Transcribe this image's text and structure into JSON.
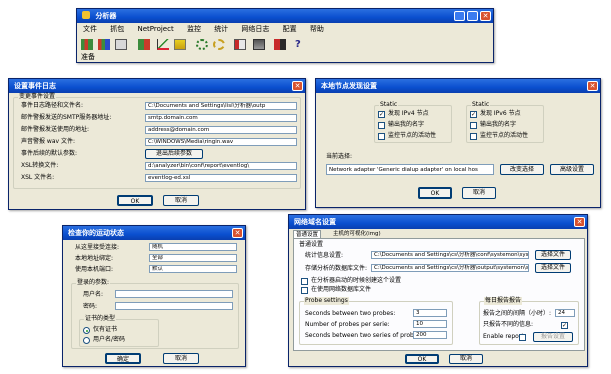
{
  "main_window": {
    "title": "分析器",
    "menu": [
      "文件",
      "抓包",
      "NetProject",
      "监控",
      "统计",
      "网络日志",
      "配置",
      "帮助"
    ],
    "toolbar_icons": [
      "tb-icon-1",
      "tb-icon-2",
      "tb-icon-3",
      "tb-icon-4",
      "tb-icon-5",
      "tb-icon-6",
      "tb-icon-7",
      "tb-icon-8",
      "tb-icon-9",
      "tb-icon-10"
    ],
    "status": "准备"
  },
  "log_dialog": {
    "title": "设置事件日志",
    "group_label": "变更事件设置",
    "rows": [
      {
        "label": "事件日志路径和文件名:",
        "value": "C:\\Documents and Settings\\lisi\\分析器\\outp"
      },
      {
        "label": "邮件警报发送的SMTP服务器地址:",
        "value": "smtp.domain.com"
      },
      {
        "label": "邮件警报发送使用的地址:",
        "value": "address@domain.com"
      },
      {
        "label": "声音警报 wav 文件:",
        "value": "C:\\WINDOWS\\Media\\ringin.wav"
      },
      {
        "label": "事件后续的默认参数:",
        "value": ""
      },
      {
        "label": "XSL转换文件:",
        "value": "d:\\analyzer\\bin\\conf\\report\\eventlog\\"
      },
      {
        "label": "XSL 文件名:",
        "value": "eventlog-ed.xsl"
      }
    ],
    "params_button": "退出后续参数",
    "ok": "OK",
    "cancel": "取消"
  },
  "node_dialog": {
    "title": "本地节点发现设置",
    "left_group": "Static",
    "left_checks": [
      {
        "label": "发现 IPv4 节点",
        "checked": true
      },
      {
        "label": "输出我的名字",
        "checked": false
      },
      {
        "label": "监控节点的活动性",
        "checked": false
      }
    ],
    "right_group": "Static",
    "right_checks": [
      {
        "label": "发现 IPv6 节点",
        "checked": true
      },
      {
        "label": "输出我的名字",
        "checked": false
      },
      {
        "label": "监控节点的活动性",
        "checked": false
      }
    ],
    "current_label": "当前选择:",
    "current_value": "Network adapter 'Generic dialup adapter' on local hos",
    "change_button": "改变选择",
    "advanced_button": "高级设置",
    "ok": "OK",
    "cancel": "取消"
  },
  "monitor_dialog": {
    "title": "检查你的运动状态",
    "rows": [
      {
        "label": "从这里接受连接:",
        "value": "随机"
      },
      {
        "label": "本地地址绑定:",
        "value": "全部"
      },
      {
        "label": "使用本机端口:",
        "value": "默认"
      }
    ],
    "login_group": "登录的参数:",
    "user_label": "用户名:",
    "pass_label": "密码:",
    "auth_group": "证书的类型",
    "radio_options": [
      {
        "label": "仅有证书",
        "selected": true
      },
      {
        "label": "用户名/密码",
        "selected": false
      }
    ],
    "ok": "确定",
    "cancel": "取消"
  },
  "netlog_dialog": {
    "title": "网络域名设置",
    "tabs": [
      "普通设置",
      "主机的可视化(img)"
    ],
    "section_label": "普通设置",
    "paths": [
      {
        "label": "统计信息设置:",
        "value": "C:\\Documents and Settings\\cs\\分析器\\conf\\systemon\\systemo",
        "button": "选择文件"
      },
      {
        "label": "存储分析的数据库文件:",
        "value": "C:\\Documents and Settings\\cs\\分析器\\output\\systemon\\systemo",
        "button": "选择文件"
      }
    ],
    "checks": [
      {
        "label": "在分析器启动的时候创建这个设置",
        "checked": false
      },
      {
        "label": "在使用网络数据库文件",
        "checked": false
      }
    ],
    "probe_group": "Probe settings",
    "probe_rows": [
      {
        "label": "Seconds between two probes:",
        "value": "3"
      },
      {
        "label": "Number of probes per serie:",
        "value": "10"
      },
      {
        "label": "Seconds between two series of probes:",
        "value": "200"
      }
    ],
    "report_group": "每日报告报告",
    "report_rows": [
      {
        "label": "报告之间的间隔（小时）:",
        "value": "24"
      },
      {
        "label": "只报告不同的信息:",
        "value": ""
      }
    ],
    "enable_label": "Enable report",
    "report_button": "报告设置",
    "ok": "OK",
    "cancel": "取消"
  }
}
